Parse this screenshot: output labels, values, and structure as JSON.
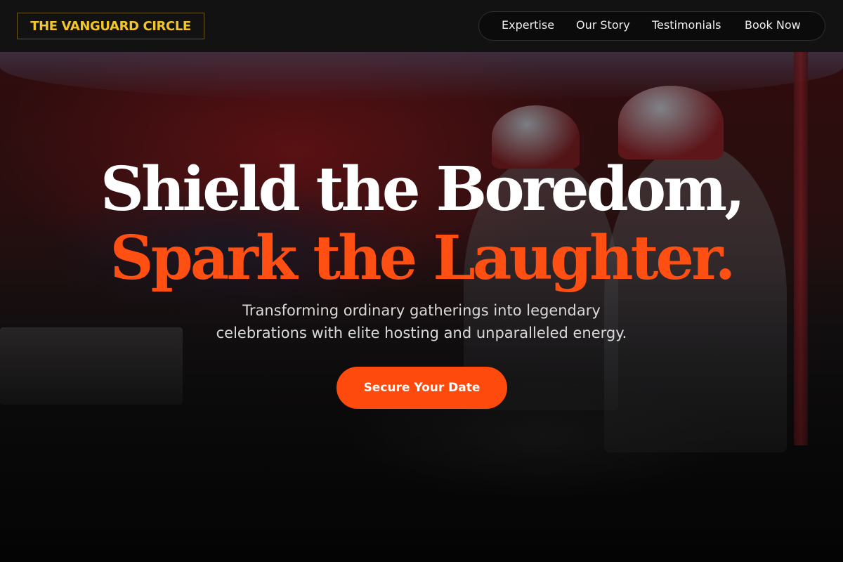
{
  "brand": {
    "name": "THE VANGUARD CIRCLE",
    "accent_color": "#f2c62a"
  },
  "nav": {
    "items": [
      {
        "label": "Expertise"
      },
      {
        "label": "Our Story"
      },
      {
        "label": "Testimonials"
      },
      {
        "label": "Book Now"
      }
    ]
  },
  "hero": {
    "headline_line1": "Shield the Boredom,",
    "headline_line2": "Spark the Laughter.",
    "headline_accent_color": "#ff4f12",
    "subtitle_line1": "Transforming ordinary gatherings into legendary",
    "subtitle_line2": "celebrations with elite hosting and unparalleled energy.",
    "cta_label": "Secure Your Date",
    "cta_color": "#ff4a0d"
  }
}
